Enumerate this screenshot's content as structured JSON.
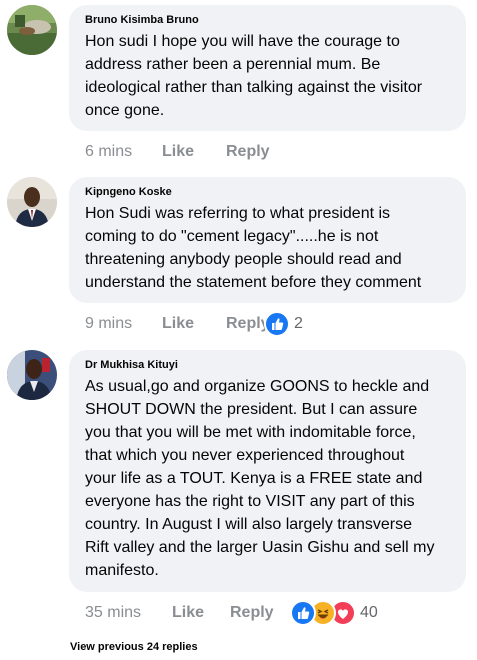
{
  "comments": [
    {
      "author": "Bruno Kisimba Bruno",
      "text": "Hon sudi I hope you will have the courage to\naddress rather been a perennial mum. Be\nideological rather than talking against the visitor\nonce gone.",
      "time": "6 mins",
      "like_label": "Like",
      "reply_label": "Reply",
      "reaction_count": ""
    },
    {
      "author": "Kipngeno Koske",
      "text": "Hon Sudi was referring to what president is\ncoming to do \"cement legacy\".....he is not\nthreatening anybody people should read and\nunderstand the statement before they comment",
      "time": "9 mins",
      "like_label": "Like",
      "reply_label": "Reply",
      "reaction_count": "2",
      "reactions": [
        "like-icon"
      ]
    },
    {
      "author": "Dr Mukhisa Kituyi",
      "text": "As usual,go and organize GOONS to heckle and\nSHOUT DOWN the president. But I can assure\nyou that you will be met with indomitable force,\nthat which you never experienced throughout\nyour life as a TOUT. Kenya is a FREE  state and\neveryone has the right to VISIT any part of this\ncountry. In August I will also largely transverse\nRift valley and the larger Uasin Gishu and sell my\nmanifesto.",
      "time": "35 mins",
      "like_label": "Like",
      "reply_label": "Reply",
      "reaction_count": "40",
      "reactions": [
        "like-icon",
        "haha-icon",
        "love-icon"
      ]
    }
  ],
  "view_previous": "View previous 24 replies",
  "colors": {
    "bubble": "#f0f2f5",
    "meta": "#8a8d91",
    "like_blue": "#1877f2",
    "love_red": "#f33e58",
    "haha_yellow": "#f7b125"
  }
}
